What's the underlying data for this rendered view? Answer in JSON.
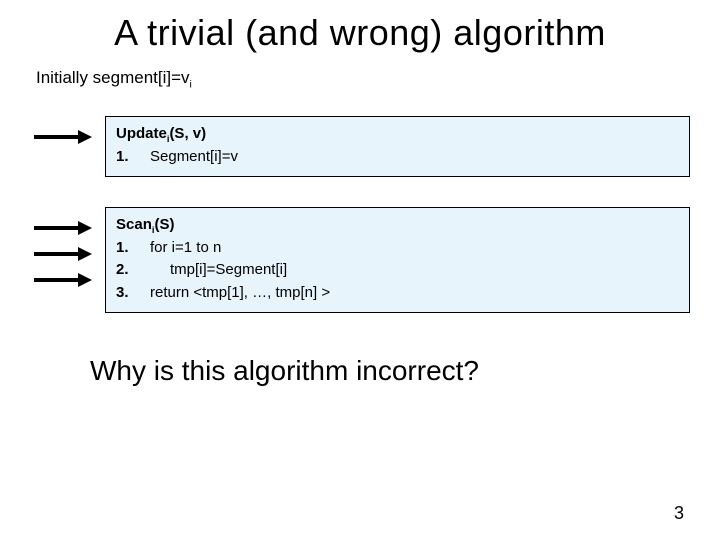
{
  "title": "A trivial (and wrong) algorithm",
  "init_prefix": "Initially segment[i]=v",
  "init_sub": "i",
  "update": {
    "head_prefix": "Update",
    "head_sub": "i",
    "head_suffix": "(S, v)",
    "lines": [
      {
        "num": "1.",
        "body": "Segment[i]=v"
      }
    ]
  },
  "scan": {
    "head_prefix": "Scan",
    "head_sub": "i",
    "head_suffix": "(S)",
    "lines": [
      {
        "num": "1.",
        "body": "for i=1 to n",
        "indent": false
      },
      {
        "num": "2.",
        "body": "tmp[i]=Segment[i]",
        "indent": true
      },
      {
        "num": "3.",
        "body": "return <tmp[1], …, tmp[n] >",
        "indent": false
      }
    ]
  },
  "question": "Why is this algorithm incorrect?",
  "page": "3"
}
